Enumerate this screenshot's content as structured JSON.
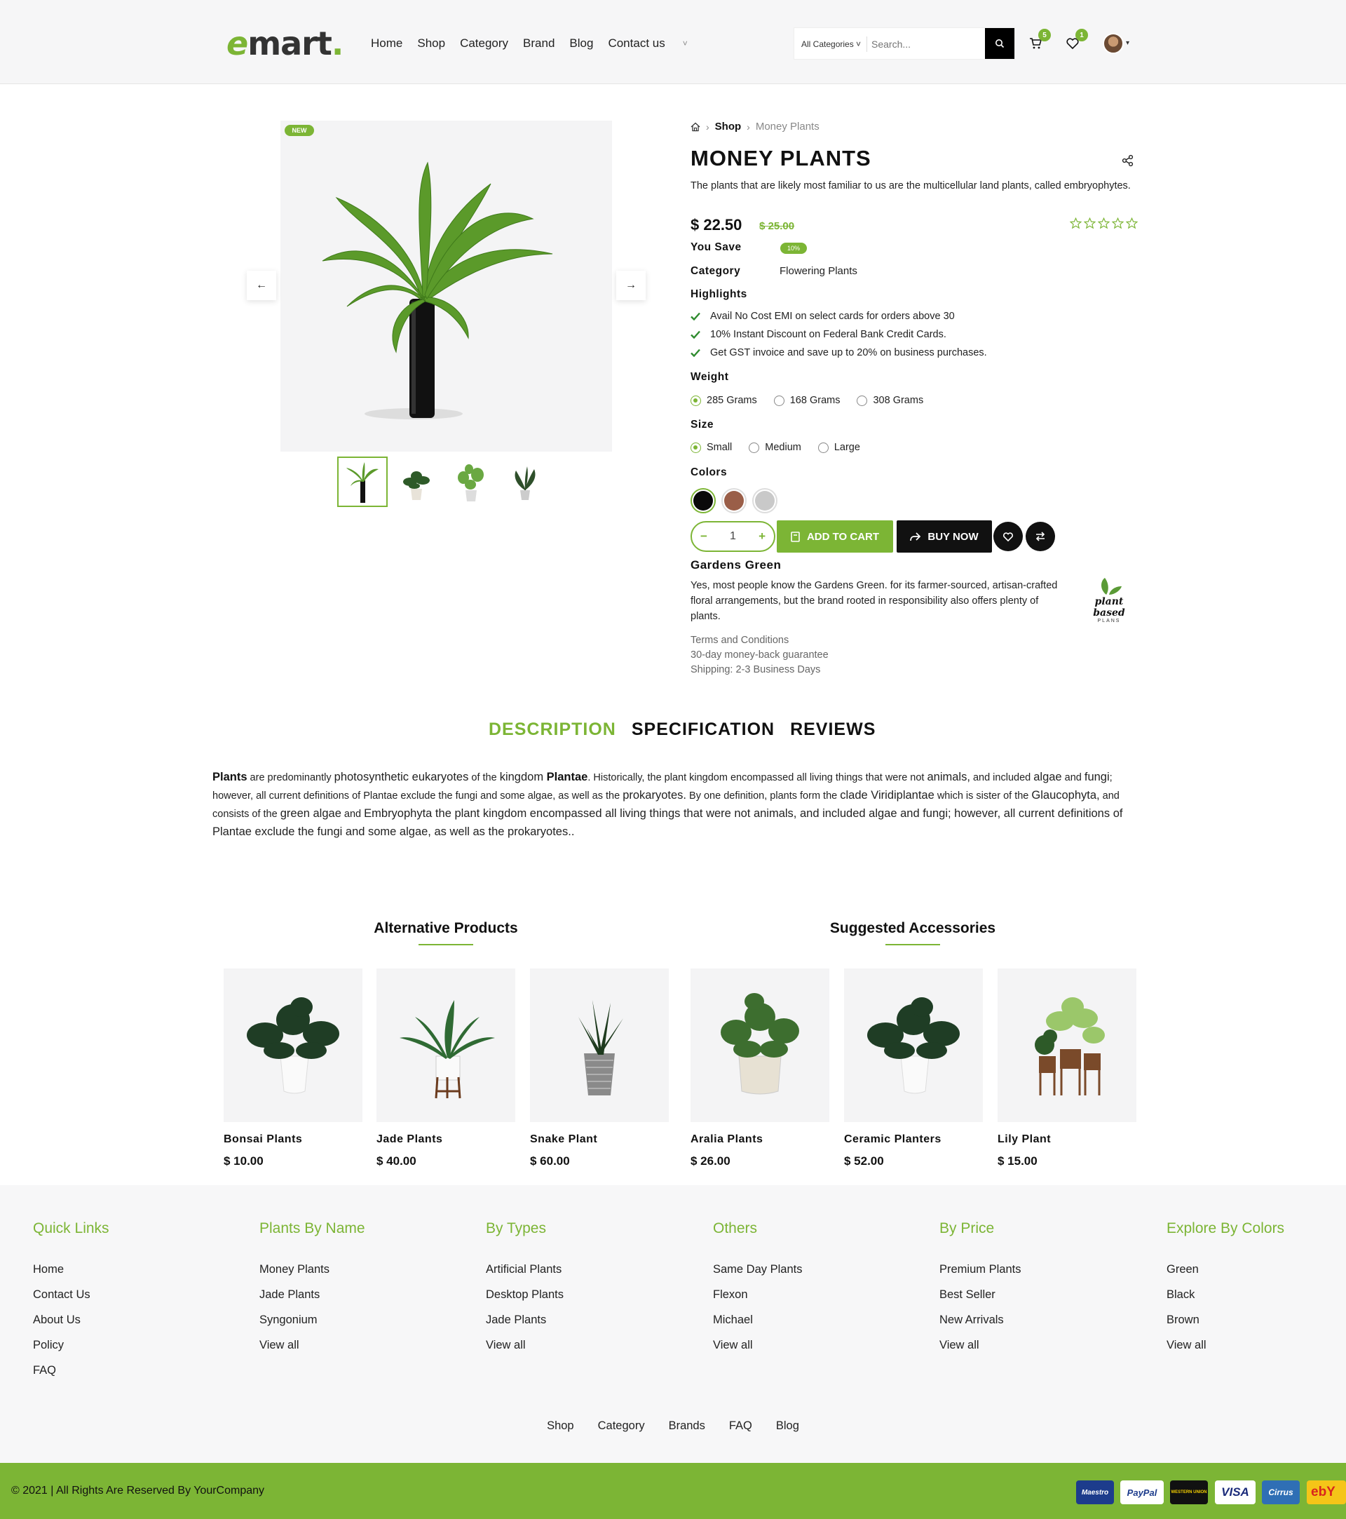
{
  "header": {
    "logo": {
      "first": "e",
      "rest": "mart",
      "dot": "."
    },
    "nav": [
      "Home",
      "Shop",
      "Category",
      "Brand",
      "Blog",
      "Contact us"
    ],
    "search_category": "All Categories",
    "search_placeholder": "Search...",
    "cart_count": "5",
    "wishlist_count": "1"
  },
  "gallery": {
    "badge": "NEW",
    "thumbnails": [
      "thumb-1",
      "thumb-2",
      "thumb-3",
      "thumb-4"
    ]
  },
  "breadcrumb": {
    "shop": "Shop",
    "current": "Money Plants"
  },
  "product": {
    "title": "MONEY PLANTS",
    "description": "The plants that are likely most familiar to us are the multicellular land plants, called embryophytes.",
    "price": "$ 22.50",
    "old_price": "$ 25.00",
    "rating": 0,
    "you_save_label": "You Save",
    "you_save_value": "10%",
    "category_label": "Category",
    "category_value": "Flowering Plants",
    "highlights_label": "Highlights",
    "highlights": [
      "Avail No Cost EMI on select cards for orders above 30",
      "10% Instant Discount on Federal Bank Credit Cards.",
      "Get GST invoice and save up to 20% on business purchases."
    ],
    "weight_label": "Weight",
    "weights": [
      "285 Grams",
      "168 Grams",
      "308 Grams"
    ],
    "size_label": "Size",
    "sizes": [
      "Small",
      "Medium",
      "Large"
    ],
    "colors_label": "Colors",
    "colors": [
      "#0a0a0a",
      "#9a5e48",
      "#c9c9c9"
    ],
    "quantity": "1",
    "add_to_cart": "ADD TO CART",
    "buy_now": "BUY NOW"
  },
  "brand": {
    "name": "Gardens Green",
    "description": "Yes, most people know the Gardens Green. for its farmer-sourced, artisan-crafted floral arrangements, but the brand rooted in responsibility also offers plenty of plants.",
    "logo_text": "plant based",
    "logo_sub": "PLANS",
    "terms": [
      "Terms and Conditions",
      "30-day money-back guarantee",
      "Shipping: 2-3 Business Days"
    ]
  },
  "tabs": [
    "DESCRIPTION",
    "SPECIFICATION",
    "REVIEWS"
  ],
  "description": {
    "p1": "Plants",
    "p2": " are predominantly ",
    "p3": "photosynthetic eukaryotes",
    "p4": " of the ",
    "p5": "kingdom ",
    "p6": "Plantae",
    "p7": ". Historically, the plant kingdom encompassed all living things that were not ",
    "p8": "animals,",
    "p9": " and included ",
    "p10": "algae",
    "p11": " and ",
    "p12": "fungi",
    "p13": "; however, all current definitions of Plantae exclude the fungi and some algae, as well as the ",
    "p14": "prokaryotes.",
    "p15": " By one definition, plants form the ",
    "p16": "clade Viridiplantae",
    "p17": " which is sister of the ",
    "p18": "Glaucophyta,",
    "p19": " and consists of the ",
    "p20": "green algae",
    "p21": " and ",
    "p22": "Embryophyta the plant kingdom encompassed all living things that were not animals, and included algae and fungi; however, all current definitions of Plantae exclude the fungi and some algae, as well as the prokaryotes.."
  },
  "related": {
    "alt_title": "Alternative Products",
    "acc_title": "Suggested Accessories",
    "products": [
      {
        "name": "Bonsai Plants",
        "price": "$ 10.00"
      },
      {
        "name": "Jade Plants",
        "price": "$ 40.00"
      },
      {
        "name": "Snake Plant",
        "price": "$ 60.00"
      },
      {
        "name": "Aralia Plants",
        "price": "$ 26.00"
      },
      {
        "name": "Ceramic Planters",
        "price": "$ 52.00"
      },
      {
        "name": "Lily Plant",
        "price": "$ 15.00"
      }
    ]
  },
  "footer": {
    "columns": [
      {
        "title": "Quick Links",
        "links": [
          "Home",
          "Contact Us",
          "About Us",
          "Policy",
          "FAQ"
        ]
      },
      {
        "title": "Plants By Name",
        "links": [
          "Money Plants",
          "Jade Plants",
          "Syngonium",
          "View all"
        ]
      },
      {
        "title": "By Types",
        "links": [
          "Artificial Plants",
          "Desktop Plants",
          "Jade Plants",
          "View all"
        ]
      },
      {
        "title": "Others",
        "links": [
          "Same Day Plants",
          "Flexon",
          "Michael",
          "View all"
        ]
      },
      {
        "title": "By Price",
        "links": [
          "Premium Plants",
          "Best Seller",
          "New Arrivals",
          "View all"
        ]
      },
      {
        "title": "Explore By Colors",
        "links": [
          "Green",
          "Black",
          "Brown",
          "View all"
        ]
      }
    ],
    "bottom_links": [
      "Shop",
      "Category",
      "Brands",
      "FAQ",
      "Blog"
    ],
    "copyright": "© 2021 | All Rights Are Reserved By YourCompany",
    "payments": [
      "Maestro",
      "PayPal",
      "WESTERN UNION",
      "VISA",
      "Cirrus",
      "ebY"
    ]
  }
}
